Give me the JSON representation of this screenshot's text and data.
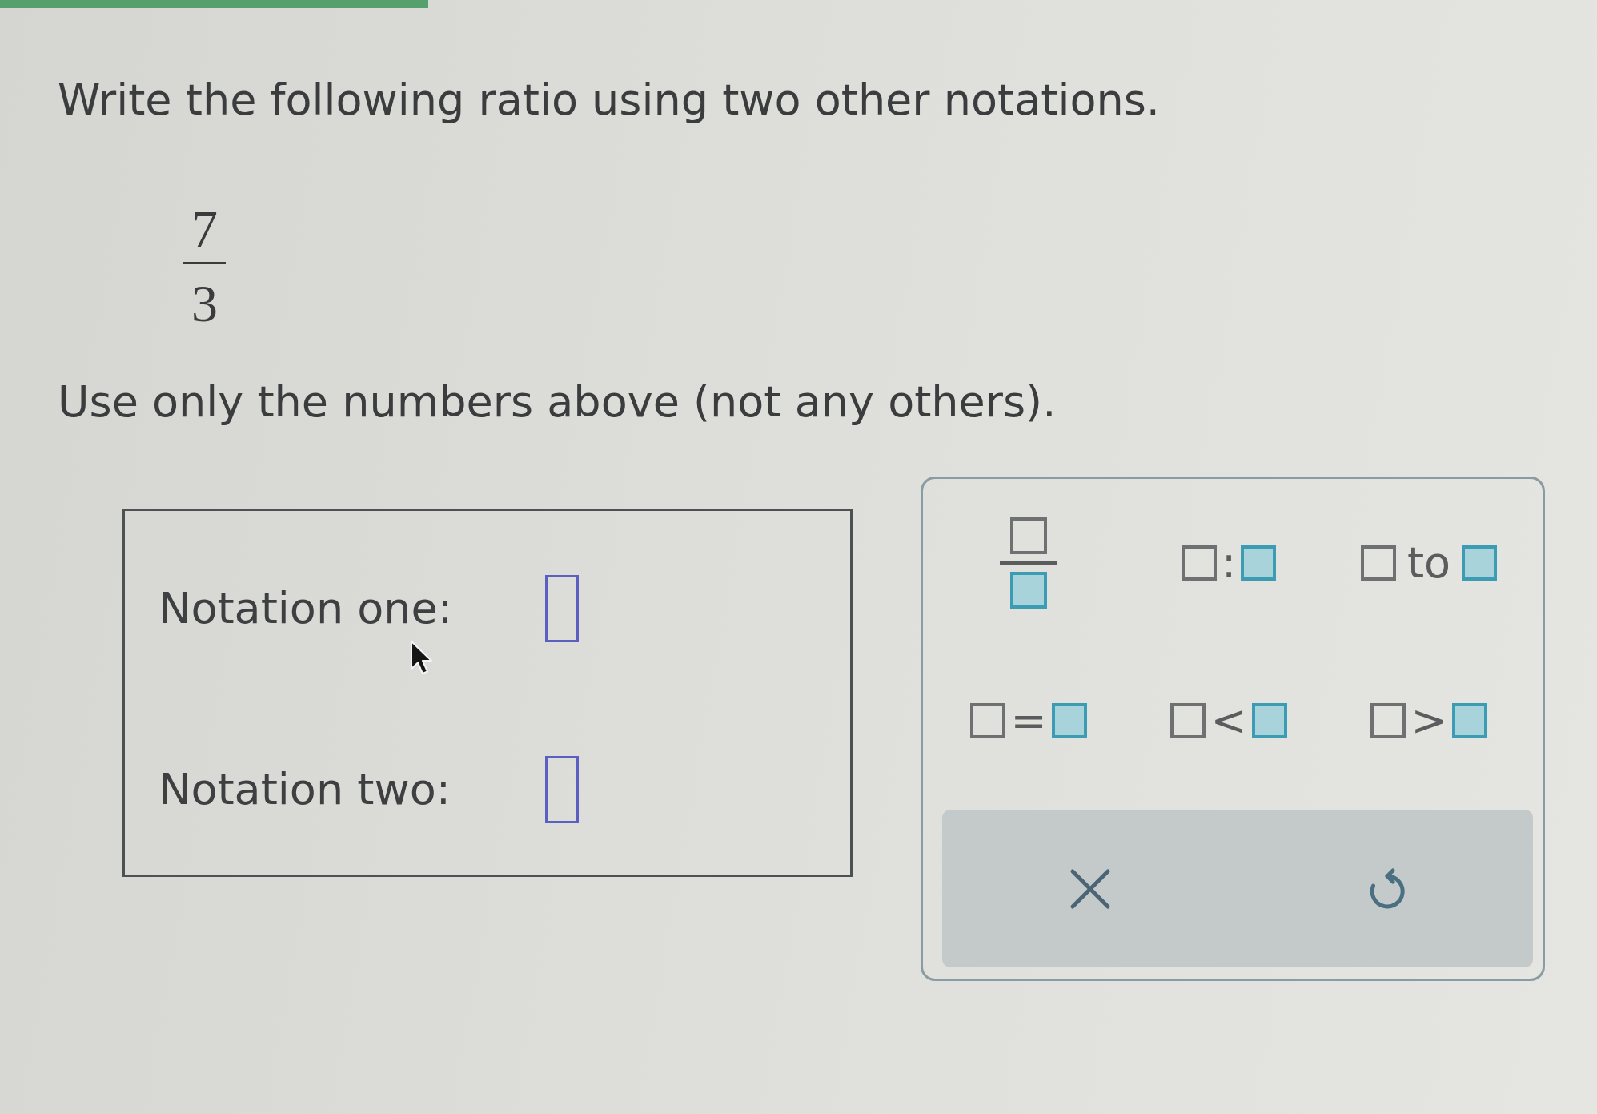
{
  "question": {
    "prompt": "Write the following ratio using two other notations.",
    "ratio": {
      "numerator": "7",
      "denominator": "3"
    },
    "instruction": "Use only the numbers above (not any others)."
  },
  "answer_panel": {
    "fields": [
      {
        "label": "Notation one:"
      },
      {
        "label": "Notation two:"
      }
    ]
  },
  "palette": {
    "templates": [
      {
        "kind": "fraction"
      },
      {
        "kind": "colon",
        "symbol": ":"
      },
      {
        "kind": "to",
        "symbol": "to"
      },
      {
        "kind": "equals",
        "symbol": "="
      },
      {
        "kind": "less_than",
        "symbol": "<"
      },
      {
        "kind": "greater_than",
        "symbol": ">"
      }
    ],
    "actions": [
      {
        "kind": "clear"
      },
      {
        "kind": "undo"
      }
    ]
  }
}
